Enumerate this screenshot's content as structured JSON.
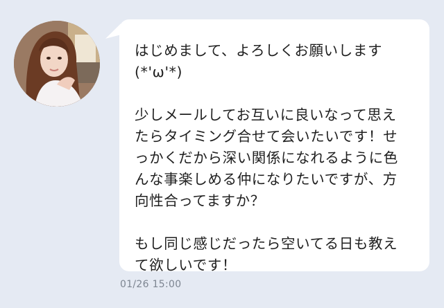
{
  "chat": {
    "message": {
      "paragraph1": [
        "はじめまして、よろしくお願いします",
        "(*'ω'*)"
      ],
      "paragraph2": [
        "少しメールしてお互いに良いなって思え",
        "たらタイミング合せて会いたいです！せ",
        "っかくだから深い関係になれるように色",
        "んな事楽しめる仲になりたいですが、方",
        "向性合ってますか？"
      ],
      "paragraph3": [
        "もし同じ感じだったら空いてる日も教え",
        "て欲しいです！"
      ],
      "timestamp": "01/26 15:00"
    }
  },
  "colors": {
    "background": "#e5eaf3",
    "bubble": "#ffffff",
    "text": "#1f1f1f",
    "timestamp": "#7d8591"
  },
  "icons": {
    "avatar": "sender-avatar-photo"
  }
}
